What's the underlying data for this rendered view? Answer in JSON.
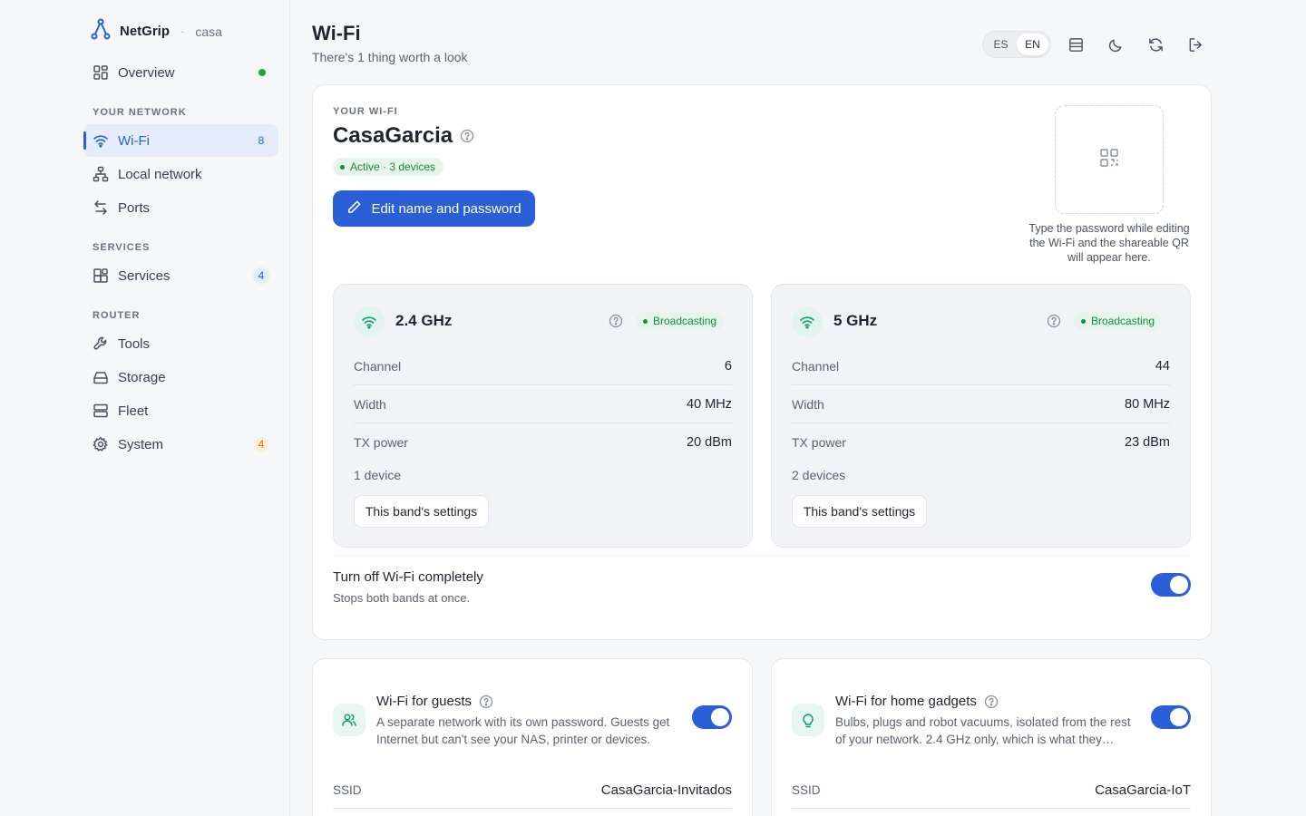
{
  "brand": {
    "name": "NetGrip",
    "separator": "·",
    "location": "casa"
  },
  "sidebar": {
    "overview": {
      "label": "Overview"
    },
    "sections": {
      "your_network": "YOUR NETWORK",
      "services": "SERVICES",
      "router": "ROUTER"
    },
    "items": [
      {
        "label": "Wi-Fi",
        "badge": "8",
        "active": true
      },
      {
        "label": "Local network"
      },
      {
        "label": "Ports"
      },
      {
        "label": "Services",
        "badge": "4"
      },
      {
        "label": "Tools"
      },
      {
        "label": "Storage"
      },
      {
        "label": "Fleet"
      },
      {
        "label": "System",
        "badge": "4"
      }
    ]
  },
  "header": {
    "title": "Wi-Fi",
    "subtitle": "There's 1 thing worth a look",
    "lang": {
      "es": "ES",
      "en": "EN",
      "selected": "EN"
    }
  },
  "wifi": {
    "eyebrow": "YOUR WI-FI",
    "ssid": "CasaGarcia",
    "status": "Active · 3 devices",
    "edit_button": "Edit name and password",
    "qr_caption": "Type the password while editing the Wi-Fi and the shareable QR will appear here.",
    "bands": [
      {
        "name": "2.4 GHz",
        "status": "Broadcasting",
        "rows": [
          {
            "k": "Channel",
            "v": "6"
          },
          {
            "k": "Width",
            "v": "40 MHz"
          },
          {
            "k": "TX power",
            "v": "20 dBm"
          }
        ],
        "devices": "1 device",
        "button": "This band's settings"
      },
      {
        "name": "5 GHz",
        "status": "Broadcasting",
        "rows": [
          {
            "k": "Channel",
            "v": "44"
          },
          {
            "k": "Width",
            "v": "80 MHz"
          },
          {
            "k": "TX power",
            "v": "23 dBm"
          }
        ],
        "devices": "2 devices",
        "button": "This band's settings"
      }
    ],
    "turn_off": {
      "title": "Turn off Wi-Fi completely",
      "subtitle": "Stops both bands at once.",
      "on": true
    }
  },
  "guest": {
    "title": "Wi-Fi for guests",
    "desc": "A separate network with its own password. Guests get Internet but can't see your NAS, printer or devices.",
    "ssid_label": "SSID",
    "ssid_value": "CasaGarcia-Invitados",
    "on": true
  },
  "gadgets": {
    "title": "Wi-Fi for home gadgets",
    "desc": "Bulbs, plugs and robot vacuums, isolated from the rest of your network. 2.4 GHz only, which is what they…",
    "ssid_label": "SSID",
    "ssid_value": "CasaGarcia-IoT",
    "on": true
  },
  "colors": {
    "accent": "#2a5fd8",
    "success": "#178a3d",
    "warning": "#c27a12"
  }
}
